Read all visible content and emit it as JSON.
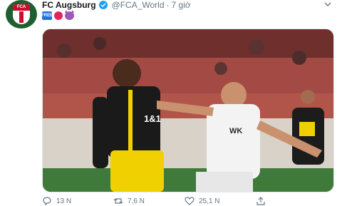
{
  "tweet": {
    "author_name": "FC Augsburg",
    "handle": "@FCA_World",
    "separator": "·",
    "time": "7 giờ",
    "verified": true,
    "emojis": [
      "FREE-icon",
      "red-circle-icon",
      "devil-icon"
    ],
    "avatar_text": "FCA"
  },
  "media": {
    "description_icons": [
      "player-yellow-kit",
      "player-white-kit"
    ],
    "jersey_sponsor_left": "1&1",
    "jersey_sponsor_right": "WK"
  },
  "actions": {
    "reply_count": "13 N",
    "retweet_count": "7,6 N",
    "like_count": "25,1 N"
  },
  "colors": {
    "accent": "#1da1f2",
    "muted": "#657786",
    "brand_green": "#1f5f2f",
    "brand_red": "#c8102e"
  }
}
